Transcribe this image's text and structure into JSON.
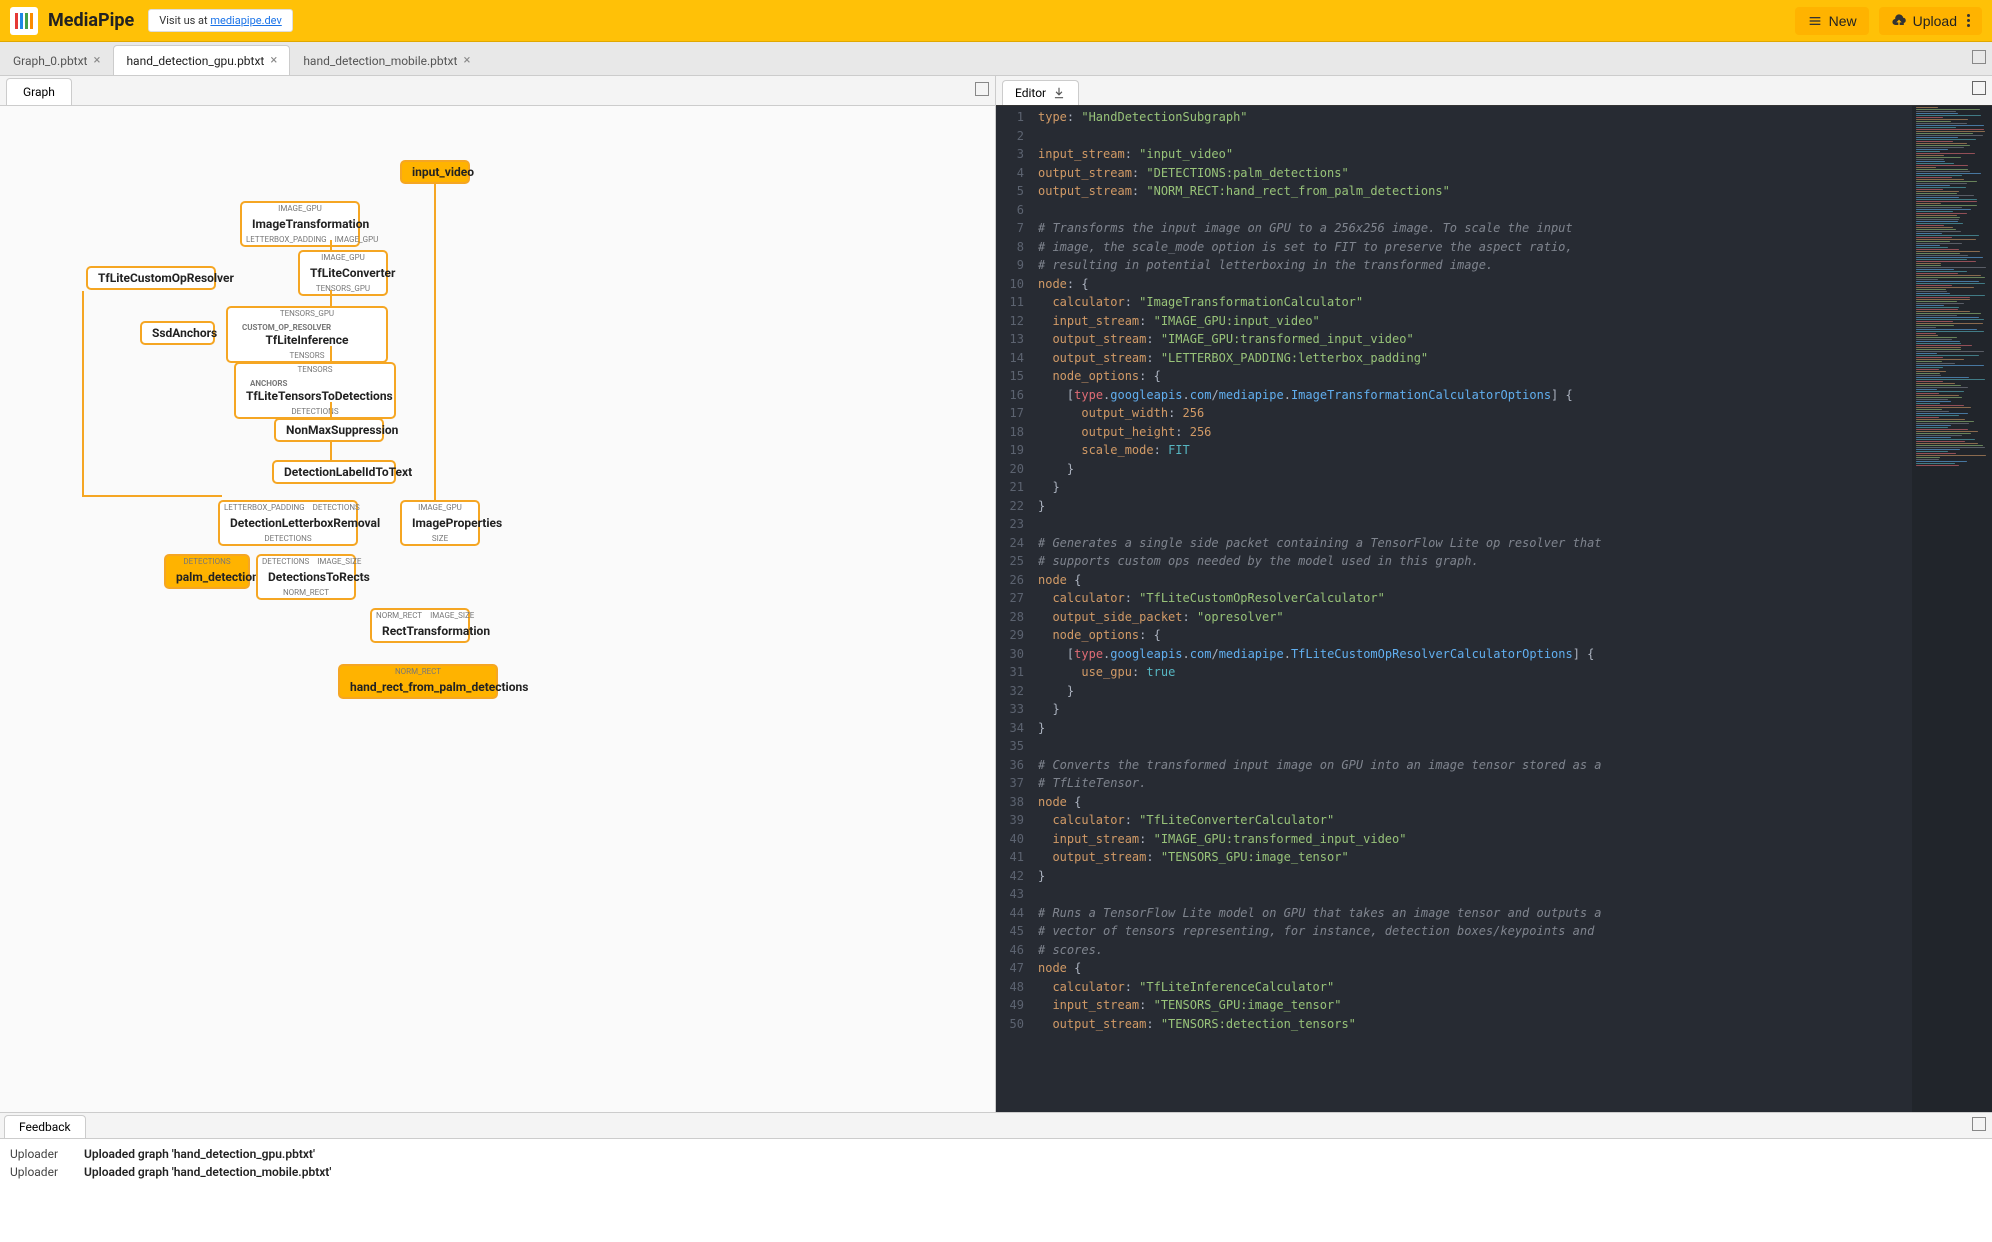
{
  "brand": "MediaPipe",
  "visit_prefix": "Visit us at ",
  "visit_link": "mediapipe.dev",
  "header_buttons": {
    "new": "New",
    "upload": "Upload"
  },
  "file_tabs": [
    {
      "label": "Graph_0.pbtxt",
      "active": false
    },
    {
      "label": "hand_detection_gpu.pbtxt",
      "active": true
    },
    {
      "label": "hand_detection_mobile.pbtxt",
      "active": false
    }
  ],
  "left_tab": "Graph",
  "editor_tab": "Editor",
  "graph": {
    "nodes": {
      "input_video": {
        "title": "input_video"
      },
      "image_transformation": {
        "top": "IMAGE_GPU",
        "title": "ImageTransformation",
        "bl": "LETTERBOX_PADDING",
        "br": "IMAGE_GPU"
      },
      "tflite_converter": {
        "top": "IMAGE_GPU",
        "title": "TfLiteConverter",
        "bottom": "TENSORS_GPU"
      },
      "tflite_custom": {
        "title": "TfLiteCustomOpResolver"
      },
      "ssd_anchors": {
        "title": "SsdAnchors"
      },
      "tflite_inference": {
        "top": "TENSORS_GPU",
        "left": "CUSTOM_OP_RESOLVER",
        "title": "TfLiteInference",
        "bottom": "TENSORS"
      },
      "tflite_t2d": {
        "top": "TENSORS",
        "left": "ANCHORS",
        "title": "TfLiteTensorsToDetections",
        "bottom": "DETECTIONS"
      },
      "nms": {
        "title": "NonMaxSuppression"
      },
      "label_to_text": {
        "title": "DetectionLabelIdToText"
      },
      "letterbox_removal": {
        "tl": "LETTERBOX_PADDING",
        "tr": "DETECTIONS",
        "title": "DetectionLetterboxRemoval",
        "bottom": "DETECTIONS"
      },
      "image_props": {
        "top": "IMAGE_GPU",
        "title": "ImageProperties",
        "bottom": "SIZE"
      },
      "palm_detections": {
        "top": "DETECTIONS",
        "title": "palm_detections"
      },
      "det_to_rects": {
        "tl": "DETECTIONS",
        "tr": "IMAGE_SIZE",
        "title": "DetectionsToRects",
        "bottom": "NORM_RECT"
      },
      "rect_transform": {
        "tl": "NORM_RECT",
        "tr": "IMAGE_SIZE",
        "title": "RectTransformation"
      },
      "hand_rect": {
        "top": "NORM_RECT",
        "title": "hand_rect_from_palm_detections"
      }
    }
  },
  "code": [
    {
      "n": 1,
      "h": "<span class='s-key'>type</span><span class='s-punc'>: </span><span class='s-str'>\"HandDetectionSubgraph\"</span>"
    },
    {
      "n": 2,
      "h": ""
    },
    {
      "n": 3,
      "h": "<span class='s-key'>input_stream</span><span class='s-punc'>: </span><span class='s-str'>\"input_video\"</span>"
    },
    {
      "n": 4,
      "h": "<span class='s-key'>output_stream</span><span class='s-punc'>: </span><span class='s-str'>\"DETECTIONS:palm_detections\"</span>"
    },
    {
      "n": 5,
      "h": "<span class='s-key'>output_stream</span><span class='s-punc'>: </span><span class='s-str'>\"NORM_RECT:hand_rect_from_palm_detections\"</span>"
    },
    {
      "n": 6,
      "h": ""
    },
    {
      "n": 7,
      "h": "<span class='s-com'># Transforms the input image on GPU to a 256x256 image. To scale the input</span>"
    },
    {
      "n": 8,
      "h": "<span class='s-com'># image, the scale_mode option is set to FIT to preserve the aspect ratio,</span>"
    },
    {
      "n": 9,
      "h": "<span class='s-com'># resulting in potential letterboxing in the transformed image.</span>"
    },
    {
      "n": 10,
      "h": "<span class='s-key'>node</span><span class='s-punc'>: {</span>"
    },
    {
      "n": 11,
      "h": "  <span class='s-key'>calculator</span><span class='s-punc'>: </span><span class='s-str'>\"ImageTransformationCalculator\"</span>"
    },
    {
      "n": 12,
      "h": "  <span class='s-key'>input_stream</span><span class='s-punc'>: </span><span class='s-str'>\"IMAGE_GPU:input_video\"</span>"
    },
    {
      "n": 13,
      "h": "  <span class='s-key'>output_stream</span><span class='s-punc'>: </span><span class='s-str'>\"IMAGE_GPU:transformed_input_video\"</span>"
    },
    {
      "n": 14,
      "h": "  <span class='s-key'>output_stream</span><span class='s-punc'>: </span><span class='s-str'>\"LETTERBOX_PADDING:letterbox_padding\"</span>"
    },
    {
      "n": 15,
      "h": "  <span class='s-key'>node_options</span><span class='s-punc'>: {</span>"
    },
    {
      "n": 16,
      "h": "    <span class='s-punc'>[</span><span class='s-type'>type</span><span class='s-punc'>.</span><span class='s-id'>googleapis</span><span class='s-punc'>.</span><span class='s-id'>com</span><span class='s-punc'>/</span><span class='s-id'>mediapipe</span><span class='s-punc'>.</span><span class='s-id'>ImageTransformationCalculatorOptions</span><span class='s-punc'>] {</span>"
    },
    {
      "n": 17,
      "h": "      <span class='s-key'>output_width</span><span class='s-punc'>: </span><span class='s-num'>256</span>"
    },
    {
      "n": 18,
      "h": "      <span class='s-key'>output_height</span><span class='s-punc'>: </span><span class='s-num'>256</span>"
    },
    {
      "n": 19,
      "h": "      <span class='s-key'>scale_mode</span><span class='s-punc'>: </span><span class='s-const'>FIT</span>"
    },
    {
      "n": 20,
      "h": "    <span class='s-punc'>}</span>"
    },
    {
      "n": 21,
      "h": "  <span class='s-punc'>}</span>"
    },
    {
      "n": 22,
      "h": "<span class='s-punc'>}</span>"
    },
    {
      "n": 23,
      "h": ""
    },
    {
      "n": 24,
      "h": "<span class='s-com'># Generates a single side packet containing a TensorFlow Lite op resolver that</span>"
    },
    {
      "n": 25,
      "h": "<span class='s-com'># supports custom ops needed by the model used in this graph.</span>"
    },
    {
      "n": 26,
      "h": "<span class='s-key'>node</span> <span class='s-punc'>{</span>"
    },
    {
      "n": 27,
      "h": "  <span class='s-key'>calculator</span><span class='s-punc'>: </span><span class='s-str'>\"TfLiteCustomOpResolverCalculator\"</span>"
    },
    {
      "n": 28,
      "h": "  <span class='s-key'>output_side_packet</span><span class='s-punc'>: </span><span class='s-str'>\"opresolver\"</span>"
    },
    {
      "n": 29,
      "h": "  <span class='s-key'>node_options</span><span class='s-punc'>: {</span>"
    },
    {
      "n": 30,
      "h": "    <span class='s-punc'>[</span><span class='s-type'>type</span><span class='s-punc'>.</span><span class='s-id'>googleapis</span><span class='s-punc'>.</span><span class='s-id'>com</span><span class='s-punc'>/</span><span class='s-id'>mediapipe</span><span class='s-punc'>.</span><span class='s-id'>TfLiteCustomOpResolverCalculatorOptions</span><span class='s-punc'>] {</span>"
    },
    {
      "n": 31,
      "h": "      <span class='s-key'>use_gpu</span><span class='s-punc'>: </span><span class='s-const'>true</span>"
    },
    {
      "n": 32,
      "h": "    <span class='s-punc'>}</span>"
    },
    {
      "n": 33,
      "h": "  <span class='s-punc'>}</span>"
    },
    {
      "n": 34,
      "h": "<span class='s-punc'>}</span>"
    },
    {
      "n": 35,
      "h": ""
    },
    {
      "n": 36,
      "h": "<span class='s-com'># Converts the transformed input image on GPU into an image tensor stored as a</span>"
    },
    {
      "n": 37,
      "h": "<span class='s-com'># TfLiteTensor.</span>"
    },
    {
      "n": 38,
      "h": "<span class='s-key'>node</span> <span class='s-punc'>{</span>"
    },
    {
      "n": 39,
      "h": "  <span class='s-key'>calculator</span><span class='s-punc'>: </span><span class='s-str'>\"TfLiteConverterCalculator\"</span>"
    },
    {
      "n": 40,
      "h": "  <span class='s-key'>input_stream</span><span class='s-punc'>: </span><span class='s-str'>\"IMAGE_GPU:transformed_input_video\"</span>"
    },
    {
      "n": 41,
      "h": "  <span class='s-key'>output_stream</span><span class='s-punc'>: </span><span class='s-str'>\"TENSORS_GPU:image_tensor\"</span>"
    },
    {
      "n": 42,
      "h": "<span class='s-punc'>}</span>"
    },
    {
      "n": 43,
      "h": ""
    },
    {
      "n": 44,
      "h": "<span class='s-com'># Runs a TensorFlow Lite model on GPU that takes an image tensor and outputs a</span>"
    },
    {
      "n": 45,
      "h": "<span class='s-com'># vector of tensors representing, for instance, detection boxes/keypoints and</span>"
    },
    {
      "n": 46,
      "h": "<span class='s-com'># scores.</span>"
    },
    {
      "n": 47,
      "h": "<span class='s-key'>node</span> <span class='s-punc'>{</span>"
    },
    {
      "n": 48,
      "h": "  <span class='s-key'>calculator</span><span class='s-punc'>: </span><span class='s-str'>\"TfLiteInferenceCalculator\"</span>"
    },
    {
      "n": 49,
      "h": "  <span class='s-key'>input_stream</span><span class='s-punc'>: </span><span class='s-str'>\"TENSORS_GPU:image_tensor\"</span>"
    },
    {
      "n": 50,
      "h": "  <span class='s-key'>output_stream</span><span class='s-punc'>: </span><span class='s-str'>\"TENSORS:detection_tensors\"</span>"
    }
  ],
  "feedback_tab": "Feedback",
  "feedback": [
    {
      "src": "Uploader",
      "msg": "Uploaded graph 'hand_detection_gpu.pbtxt'"
    },
    {
      "src": "Uploader",
      "msg": "Uploaded graph 'hand_detection_mobile.pbtxt'"
    }
  ]
}
